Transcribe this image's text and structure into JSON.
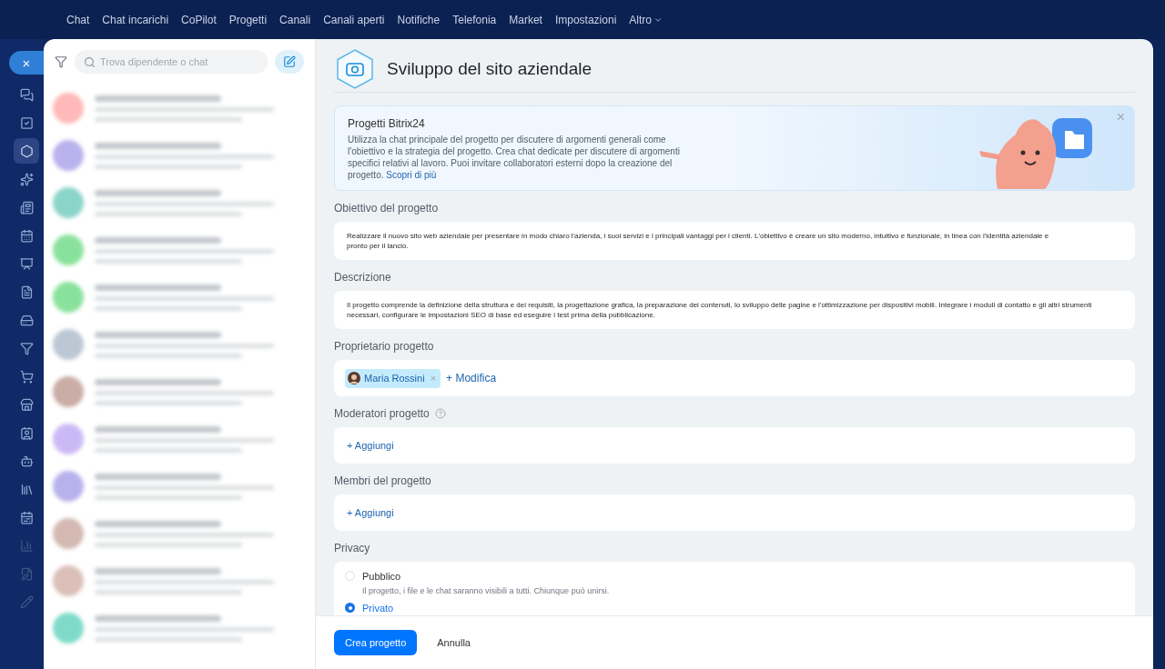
{
  "top_nav": [
    {
      "label": "Chat"
    },
    {
      "label": "Chat incarichi"
    },
    {
      "label": "CoPilot"
    },
    {
      "label": "Progetti"
    },
    {
      "label": "Canali"
    },
    {
      "label": "Canali aperti"
    },
    {
      "label": "Notifiche"
    },
    {
      "label": "Telefonia"
    },
    {
      "label": "Market"
    },
    {
      "label": "Impostazioni"
    },
    {
      "label": "Altro",
      "kind": "dropdown"
    }
  ],
  "sidebar": {
    "close_label": "×",
    "items": [
      {
        "selected": false
      },
      {
        "selected": false
      },
      {
        "selected": true
      },
      {
        "selected": false
      },
      {
        "selected": false
      },
      {
        "selected": false
      },
      {
        "selected": false
      },
      {
        "selected": false
      },
      {
        "selected": false
      },
      {
        "selected": false
      },
      {
        "selected": false
      },
      {
        "selected": false
      },
      {
        "selected": false
      },
      {
        "selected": false
      },
      {
        "selected": false
      },
      {
        "selected": false
      },
      {
        "selected": false
      },
      {
        "selected": false
      },
      {
        "selected": false
      }
    ]
  },
  "chat_list": {
    "search": {
      "placeholder": "Trova dipendente o chat"
    }
  },
  "form": {
    "title": "Sviluppo del sito aziendale",
    "banner": {
      "title": "Progetti Bitrix24",
      "text": "Utilizza la chat principale del progetto per discutere di argomenti generali come l'obiettivo e la strategia del progetto. Crea chat dedicate per discutere di argomenti specifici relativi al lavoro. Puoi invitare collaboratori esterni dopo la creazione del progetto.",
      "link": "Scopri di più",
      "close": "×"
    },
    "goal": {
      "label": "Obiettivo del progetto",
      "value": "Realizzare il nuovo sito web aziendale per presentare in modo chiaro l'azienda, i suoi servizi e i principali vantaggi per i clienti. L'obiettivo è creare un sito moderno, intuitivo e funzionale, in linea con l'identità aziendale e pronto per il lancio."
    },
    "description": {
      "label": "Descrizione",
      "value": "Il progetto comprende la definizione della struttura e dei requisiti, la progettazione grafica, la preparazione dei contenuti, lo sviluppo delle pagine e l'ottimizzazione per dispositivi mobili. Integrare i moduli di contatto e gli altri strumenti necessari, configurare le impostazioni SEO di base ed eseguire i test prima della pubblicazione."
    },
    "owner": {
      "label": "Proprietario progetto",
      "name": "Maria Rossini",
      "remove": "×",
      "action": "+ Modifica"
    },
    "moderators": {
      "label": "Moderatori progetto",
      "help": true,
      "action": "+ Aggiungi"
    },
    "members": {
      "label": "Membri del progetto",
      "action": "+ Aggiungi"
    },
    "privacy": {
      "label": "Privacy",
      "options": [
        {
          "label": "Pubblico",
          "hint": "Il progetto, i file e le chat saranno visibili a tutti. Chiunque può unirsi.",
          "selected": false
        },
        {
          "label": "Privato",
          "selected": true
        }
      ]
    },
    "buttons": [
      {
        "label": "Crea progetto",
        "kind": "primary"
      },
      {
        "label": "Annulla",
        "kind": "secondary"
      }
    ]
  }
}
